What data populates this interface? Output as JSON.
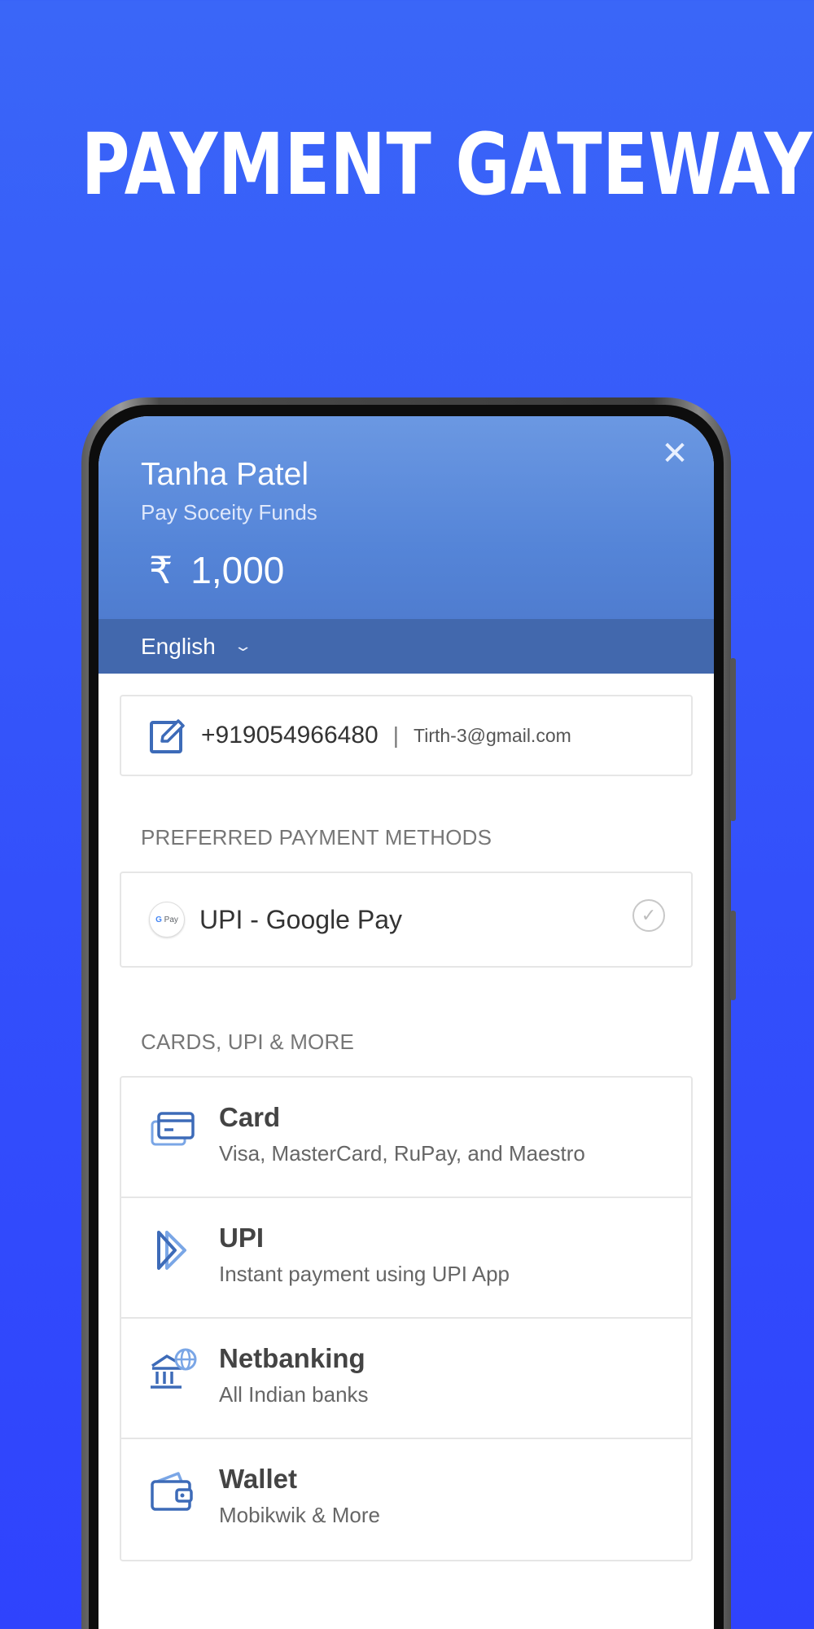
{
  "headline": "PAYMENT GATEWAY",
  "header": {
    "payer_name": "Tanha Patel",
    "purpose": "Pay Soceity Funds",
    "currency_symbol": "₹",
    "amount": "1,000",
    "close_icon": "close-icon"
  },
  "language": {
    "selected": "English"
  },
  "contact": {
    "phone": "+919054966480",
    "separator": "|",
    "email": "Tirth-3@gmail.com"
  },
  "preferred": {
    "title": "PREFERRED PAYMENT METHODS",
    "items": [
      {
        "label": "UPI - Google Pay",
        "icon": "gpay-icon",
        "icon_text_g": "G",
        "icon_text_pay": "Pay"
      }
    ]
  },
  "more": {
    "title": "CARDS, UPI & MORE",
    "methods": [
      {
        "name": "Card",
        "desc": "Visa, MasterCard, RuPay, and Maestro",
        "icon": "card-icon"
      },
      {
        "name": "UPI",
        "desc": "Instant payment using UPI App",
        "icon": "upi-icon"
      },
      {
        "name": "Netbanking",
        "desc": "All Indian banks",
        "icon": "bank-icon"
      },
      {
        "name": "Wallet",
        "desc": "Mobikwik & More",
        "icon": "wallet-icon"
      }
    ]
  },
  "colors": {
    "background": "#3350fb",
    "header": "#5585d8",
    "language_bar": "#4268ad",
    "icon_blue": "#3d6bb8"
  }
}
